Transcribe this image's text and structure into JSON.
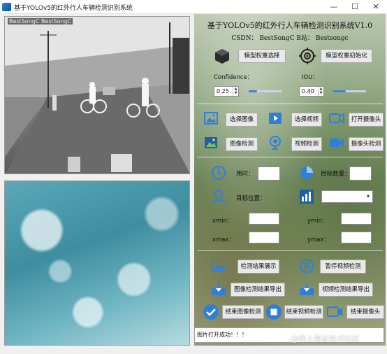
{
  "window": {
    "title": "基于YOLOv5的红外行人车辆检测识别系统",
    "minimize": "—",
    "maximize": "☐",
    "close": "✕"
  },
  "video_pane": {
    "overlay_text": "BestSongC BestSongC"
  },
  "header": {
    "title": "基于YOLOv5的红外行人车辆检测识别系统V1.0",
    "subtitle": "CSDN：  BestSongC    B站：  Bestsongc"
  },
  "model": {
    "select_label": "模型权重选择",
    "init_label": "模型权重初始化"
  },
  "params": {
    "confidence_label": "Confidence：",
    "iou_label": "IOU：",
    "confidence_value": "0.25",
    "iou_value": "0.40",
    "confidence_slider_fraction": 0.25,
    "iou_slider_fraction": 0.4
  },
  "source_buttons": {
    "select_image": "选择图像",
    "select_video": "选择视频",
    "open_camera": "打开摄像头",
    "image_detect": "图像检测",
    "video_detect": "视频检测",
    "camera_detect": "摄像头检测"
  },
  "results": {
    "time_label": "用时：",
    "count_label": "目标数量：",
    "position_label": "目标位置：",
    "xmin_label": "xmin：",
    "ymin_label": "ymin：",
    "xmax_label": "xmax：",
    "ymax_label": "ymax："
  },
  "actions": {
    "show_results": "检测结果展示",
    "pause_video": "暂停视频检测",
    "export_image": "图像检测结果导出",
    "export_video": "视频检测结果导出",
    "end_image": "结束图像检测",
    "end_video": "结束视频检测",
    "end_camera": "结束摄像头"
  },
  "status": {
    "message": "图片打开成功！！！"
  },
  "watermark": "@稀土掘金技术社区",
  "colors": {
    "accent": "#2f7fd8",
    "icon_dark": "#222222"
  }
}
